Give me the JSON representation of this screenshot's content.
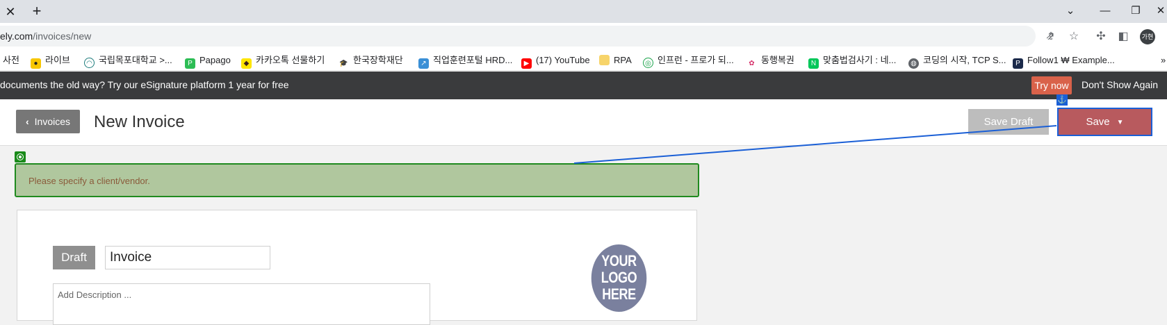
{
  "browser": {
    "tab_close": "✕",
    "new_tab": "+",
    "window_controls": {
      "dropdown": "⌄",
      "minimize": "—",
      "restore": "❐",
      "close": "✕"
    },
    "url_domain": "ely.com",
    "url_path": "/invoices/new",
    "profile_initial": "가현",
    "bookmarks": [
      {
        "label": "사전",
        "icon": "none"
      },
      {
        "label": "라이브",
        "icon": "live-icon"
      },
      {
        "label": "국립목포대학교 >...",
        "icon": "university-icon"
      },
      {
        "label": "Papago",
        "icon": "papago-icon"
      },
      {
        "label": "카카오톡 선물하기",
        "icon": "kakao-icon"
      },
      {
        "label": "한국장학재단",
        "icon": "scholarship-icon"
      },
      {
        "label": "직업훈련포털 HRD...",
        "icon": "hrd-icon"
      },
      {
        "label": "(17) YouTube",
        "icon": "youtube-icon"
      },
      {
        "label": "RPA",
        "icon": "folder-icon"
      },
      {
        "label": "인프런 - 프로가 되...",
        "icon": "inflearn-icon"
      },
      {
        "label": "동행복권",
        "icon": "lottery-icon"
      },
      {
        "label": "맞춤법검사기 : 네...",
        "icon": "naver-icon"
      },
      {
        "label": "코딩의 시작, TCP S...",
        "icon": "globe-icon"
      },
      {
        "label": "Follow1 ₩ Example...",
        "icon": "p-icon"
      }
    ],
    "bookmarks_more": "»"
  },
  "promo": {
    "text": "documents the old way? Try our eSignature platform 1 year for free",
    "try_label": "Try now",
    "dismiss_label": "Don't Show Again"
  },
  "header": {
    "back_label": "Invoices",
    "title": "New Invoice",
    "save_draft_label": "Save Draft",
    "save_label": "Save"
  },
  "alert": {
    "message": "Please specify a client/vendor."
  },
  "invoice": {
    "status": "Draft",
    "title_value": "Invoice",
    "description_placeholder": "Add Description ...",
    "logo_text_1": "YOUR",
    "logo_text_2": "LOGO",
    "logo_text_3": "HERE"
  },
  "colors": {
    "promo_bg": "#3a3b3d",
    "try_button": "#d9624a",
    "save_button": "#b85a5e",
    "alert_bg": "#b0c79e",
    "highlight_blue": "#1a5fd6",
    "highlight_green": "#1f8a1f"
  }
}
